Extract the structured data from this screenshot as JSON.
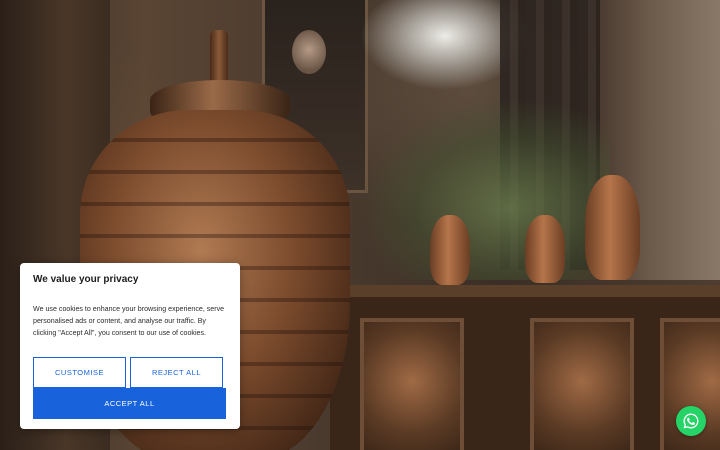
{
  "cookie_banner": {
    "title": "We value your privacy",
    "message": "We use cookies to enhance your browsing experience, serve personalised ads or content, and analyse our traffic. By clicking \"Accept All\", you consent to our use of cookies.",
    "customise_label": "CUSTOMISE",
    "reject_label": "REJECT ALL",
    "accept_label": "ACCEPT ALL"
  },
  "floating_chat": {
    "icon": "whatsapp-icon"
  },
  "colors": {
    "accent": "#1863dc",
    "whatsapp_green": "#25d366",
    "banner_background": "#ffffff"
  }
}
